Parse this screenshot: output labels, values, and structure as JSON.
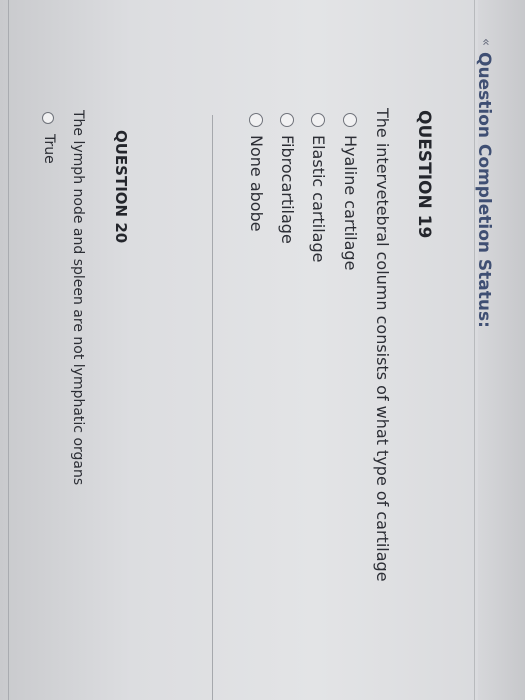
{
  "header": {
    "chevron": "«",
    "status_label": "Question Completion Status:"
  },
  "questions": [
    {
      "number_label": "QUESTION 19",
      "prompt": "The intervetebral column consists of what type of cartilage",
      "options": [
        {
          "label": "Hyaline cartilage"
        },
        {
          "label": "Elastic cartilage"
        },
        {
          "label": "Fibrocartilage"
        },
        {
          "label": "None abobe"
        }
      ]
    },
    {
      "number_label": "QUESTION 20",
      "prompt": "The lymph node and spleen are not lymphatic organs",
      "options": [
        {
          "label": "True"
        }
      ]
    }
  ],
  "colors": {
    "status_text": "#3f4f73",
    "panel_bg": "#e6e6e8"
  },
  "icons": [
    "chevron-double-left-icon",
    "radio-button-icon"
  ]
}
